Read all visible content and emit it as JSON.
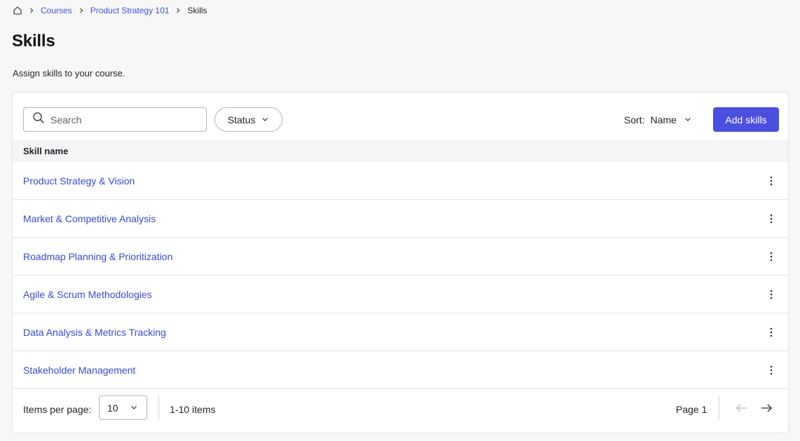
{
  "breadcrumb": {
    "home_icon": "home-icon",
    "items": [
      "Courses",
      "Product Strategy 101"
    ],
    "current": "Skills"
  },
  "page": {
    "title": "Skills",
    "subtitle": "Assign skills to your course."
  },
  "toolbar": {
    "search_placeholder": "Search",
    "status_label": "Status",
    "sort_label": "Sort:",
    "sort_value": "Name",
    "add_label": "Add skills",
    "accent_color": "#4a4fe0"
  },
  "table": {
    "column_header": "Skill name",
    "rows": [
      "Product Strategy & Vision",
      "Market & Competitive Analysis",
      "Roadmap Planning & Prioritization",
      "Agile & Scrum Methodologies",
      "Data Analysis & Metrics Tracking",
      "Stakeholder Management"
    ]
  },
  "footer": {
    "items_per_page_label": "Items per page:",
    "items_per_page_value": "10",
    "range_text": "1-10 items",
    "page_text": "Page 1"
  }
}
